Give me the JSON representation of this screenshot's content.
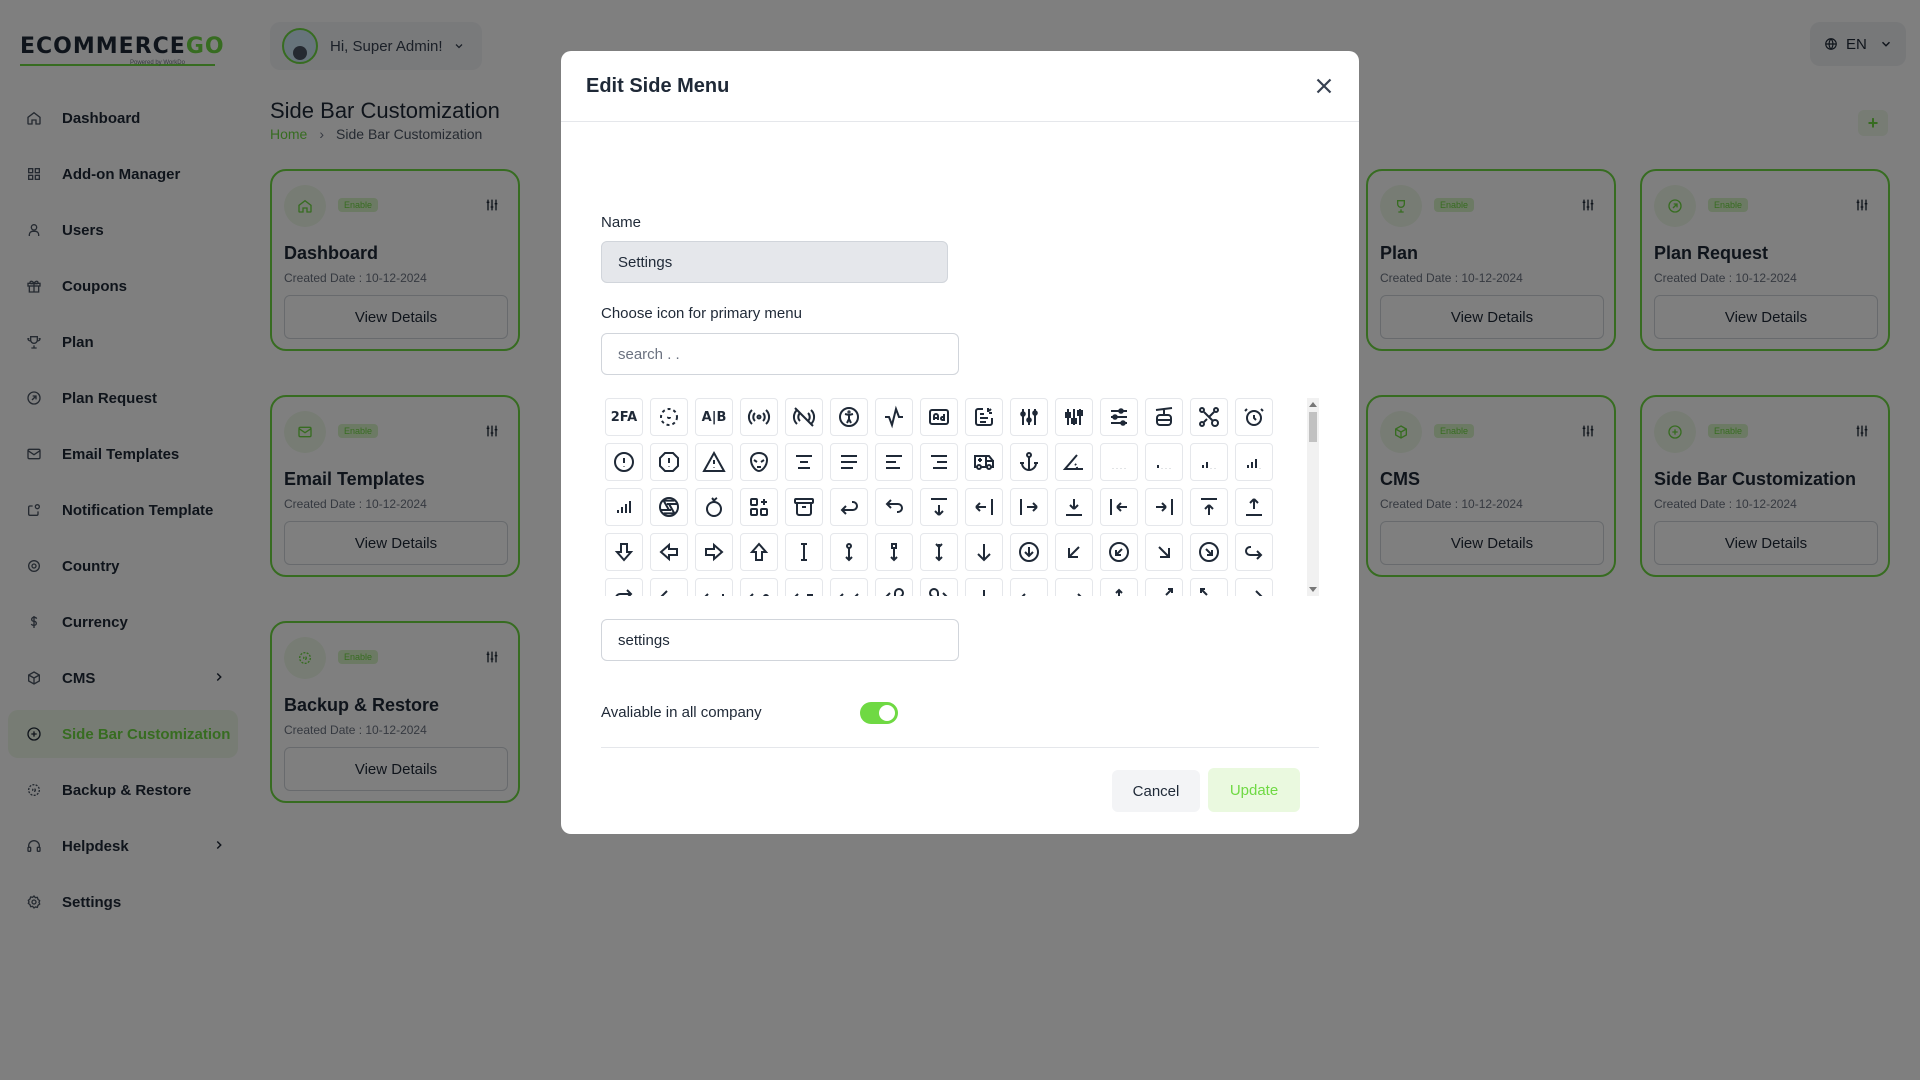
{
  "brand": {
    "logo_main": "ECOMMERCE",
    "logo_accent": "GO",
    "logo_sub": "Powered by WorkDo"
  },
  "sidebar": {
    "items": [
      {
        "label": "Dashboard",
        "icon": "home-icon"
      },
      {
        "label": "Add-on Manager",
        "icon": "apps-icon"
      },
      {
        "label": "Users",
        "icon": "user-icon"
      },
      {
        "label": "Coupons",
        "icon": "gift-icon"
      },
      {
        "label": "Plan",
        "icon": "trophy-icon"
      },
      {
        "label": "Plan Request",
        "icon": "arrow-circle-icon"
      },
      {
        "label": "Email Templates",
        "icon": "mail-icon"
      },
      {
        "label": "Notification Template",
        "icon": "notification-icon"
      },
      {
        "label": "Country",
        "icon": "location-icon"
      },
      {
        "label": "Currency",
        "icon": "dollar-icon"
      },
      {
        "label": "CMS",
        "icon": "package-icon"
      },
      {
        "label": "Side Bar Customization",
        "icon": "plus-circle-icon"
      },
      {
        "label": "Backup & Restore",
        "icon": "backup-icon"
      },
      {
        "label": "Helpdesk",
        "icon": "headset-icon"
      },
      {
        "label": "Settings",
        "icon": "settings-icon"
      }
    ]
  },
  "header": {
    "greeting": "Hi, Super Admin!",
    "language": "EN",
    "page_title": "Side Bar Customization",
    "breadcrumb_home": "Home",
    "breadcrumb_current": "Side Bar Customization",
    "add_label": "+"
  },
  "cards": [
    {
      "title": "Dashboard",
      "badge": "Enable",
      "date": "Created Date : 10-12-2024",
      "button": "View Details"
    },
    {
      "title": "Plan",
      "badge": "Enable",
      "date": "Created Date : 10-12-2024",
      "button": "View Details"
    },
    {
      "title": "Plan Request",
      "badge": "Enable",
      "date": "Created Date : 10-12-2024",
      "button": "View Details"
    },
    {
      "title": "Email Templates",
      "badge": "Enable",
      "date": "Created Date : 10-12-2024",
      "button": "View Details"
    },
    {
      "title": "CMS",
      "badge": "Enable",
      "date": "Created Date : 10-12-2024",
      "button": "View Details"
    },
    {
      "title": "Side Bar Customization",
      "badge": "Enable",
      "date": "Created Date : 10-12-2024",
      "button": "View Details"
    },
    {
      "title": "Backup & Restore",
      "badge": "Enable",
      "date": "Created Date : 10-12-2024",
      "button": "View Details"
    }
  ],
  "modal": {
    "title": "Edit Side Menu",
    "name_label": "Name",
    "name_value": "Settings",
    "icon_label": "Choose icon for primary menu",
    "search_placeholder": "search . .",
    "selected_icon": "settings",
    "toggle_label": "Avaliable in all company",
    "toggle_on": true,
    "cancel_label": "Cancel",
    "update_label": "Update",
    "icons_row1_text": [
      "2FA",
      "A|B"
    ]
  },
  "colors": {
    "accent": "#6fd943",
    "accent_light": "#eef9e8",
    "overlay": "rgba(0,0,0,0.5)"
  }
}
